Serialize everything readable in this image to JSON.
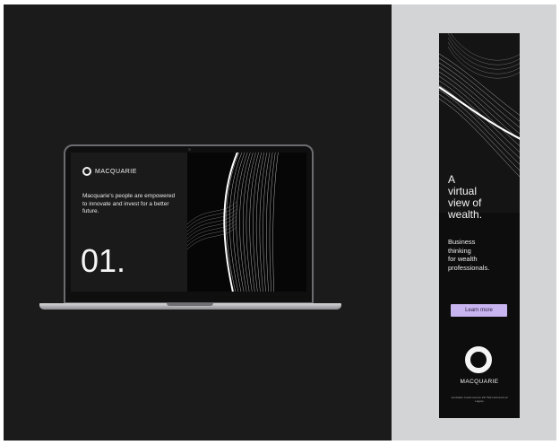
{
  "laptop_screen": {
    "brand": "MACQUARIE",
    "tagline": "Macquarie's people are empowered to innovate and invest for a better future.",
    "slide_number": "01."
  },
  "banner_ad": {
    "headline_lines": [
      "A",
      "virtual",
      "view of",
      "wealth."
    ],
    "subline_lines": [
      "Business",
      "thinking",
      "for wealth",
      "professionals."
    ],
    "cta_label": "Learn more",
    "brand": "MACQUARIE",
    "fine_print": "Australian Credit Licence 237 502 Hold and Ltd Legacy"
  },
  "colors": {
    "canvas_bg": "#1b1b1b",
    "panel_bg": "#d3d4d6",
    "cta_bg": "#c8b4ee",
    "text_light": "#f4f4f4"
  }
}
